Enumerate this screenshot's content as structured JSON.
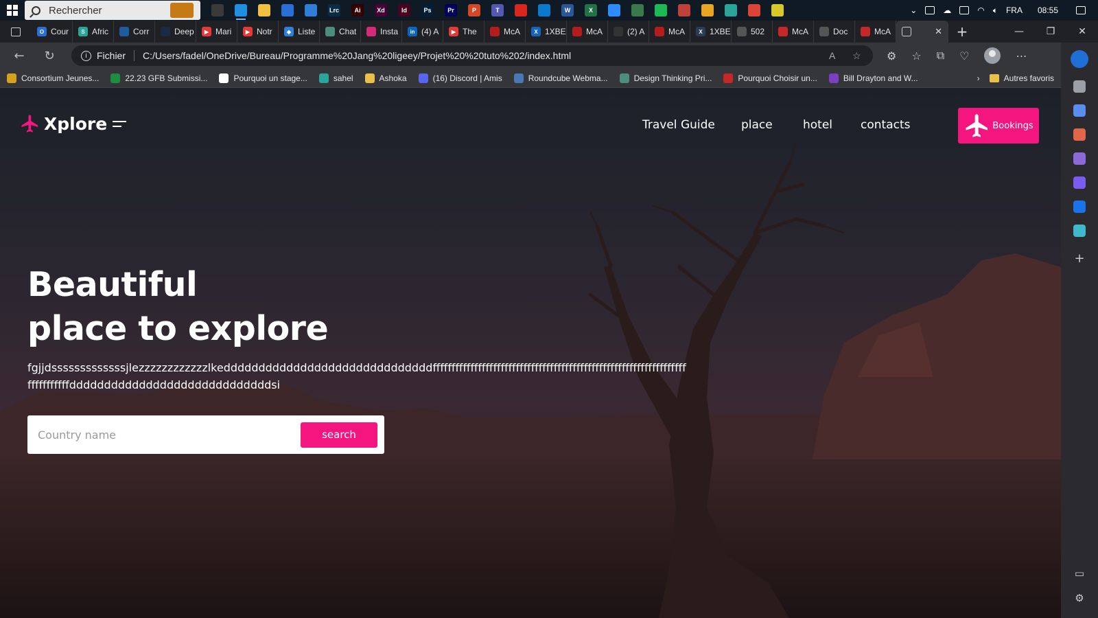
{
  "taskbar": {
    "search_placeholder": "Rechercher",
    "language": "FRA",
    "time": "08:55",
    "apps": [
      {
        "name": "task-view",
        "color": "#3a3a3a",
        "glyph": ""
      },
      {
        "name": "edge",
        "color": "#1f8fe0",
        "glyph": ""
      },
      {
        "name": "file-explorer",
        "color": "#f0c040",
        "glyph": ""
      },
      {
        "name": "store",
        "color": "#2b6fd6",
        "glyph": ""
      },
      {
        "name": "mail",
        "color": "#2f7fd8",
        "glyph": ""
      },
      {
        "name": "lightroom",
        "color": "#0b2a44",
        "glyph": "Lrc"
      },
      {
        "name": "illustrator",
        "color": "#330000",
        "glyph": "Ai"
      },
      {
        "name": "xd",
        "color": "#470137",
        "glyph": "Xd"
      },
      {
        "name": "indesign",
        "color": "#49021f",
        "glyph": "Id"
      },
      {
        "name": "photoshop",
        "color": "#001e36",
        "glyph": "Ps"
      },
      {
        "name": "premiere",
        "color": "#00005b",
        "glyph": "Pr"
      },
      {
        "name": "powerpoint",
        "color": "#d24726",
        "glyph": "P"
      },
      {
        "name": "teams",
        "color": "#5558af",
        "glyph": "T"
      },
      {
        "name": "acrobat",
        "color": "#d9261c",
        "glyph": ""
      },
      {
        "name": "vscode",
        "color": "#0a7acc",
        "glyph": ""
      },
      {
        "name": "word",
        "color": "#2b579a",
        "glyph": "W"
      },
      {
        "name": "excel",
        "color": "#217346",
        "glyph": "X"
      },
      {
        "name": "zoom",
        "color": "#2d8cff",
        "glyph": ""
      },
      {
        "name": "download",
        "color": "#3a7a4a",
        "glyph": ""
      },
      {
        "name": "spotify",
        "color": "#1db954",
        "glyph": ""
      },
      {
        "name": "app-circle",
        "color": "#c0403a",
        "glyph": ""
      },
      {
        "name": "chrome",
        "color": "#e7a521",
        "glyph": ""
      },
      {
        "name": "app-green",
        "color": "#2aa59a",
        "glyph": ""
      },
      {
        "name": "chrome-2",
        "color": "#db4437",
        "glyph": ""
      },
      {
        "name": "app-yellow",
        "color": "#d8c82a",
        "glyph": ""
      }
    ]
  },
  "tabs": [
    {
      "label": "Cour",
      "color": "#2b6fd6",
      "glyph": "O"
    },
    {
      "label": "Afric",
      "color": "#2aa59a",
      "glyph": "S"
    },
    {
      "label": "Corr",
      "color": "#1f5c9e",
      "glyph": ""
    },
    {
      "label": "Deep",
      "color": "#1b2a44",
      "glyph": ""
    },
    {
      "label": "Mari",
      "color": "#e53935",
      "glyph": "▶"
    },
    {
      "label": "Notr",
      "color": "#e53935",
      "glyph": "▶"
    },
    {
      "label": "Liste",
      "color": "#2f7fd8",
      "glyph": "◆"
    },
    {
      "label": "Chat",
      "color": "#4a8f7d",
      "glyph": ""
    },
    {
      "label": "Insta",
      "color": "#d62976",
      "glyph": ""
    },
    {
      "label": "(4) A",
      "color": "#0a66c2",
      "glyph": "in"
    },
    {
      "label": "The",
      "color": "#e53935",
      "glyph": "▶"
    },
    {
      "label": "McA",
      "color": "#b71c1c",
      "glyph": ""
    },
    {
      "label": "1XBE",
      "color": "#1565c0",
      "glyph": "X"
    },
    {
      "label": "McA",
      "color": "#b71c1c",
      "glyph": ""
    },
    {
      "label": "(2) A",
      "color": "#333",
      "glyph": ""
    },
    {
      "label": "McA",
      "color": "#b71c1c",
      "glyph": ""
    },
    {
      "label": "1XBE",
      "color": "#2b3c55",
      "glyph": "X"
    },
    {
      "label": "502",
      "color": "#555",
      "glyph": ""
    },
    {
      "label": "McA",
      "color": "#c62828",
      "glyph": ""
    },
    {
      "label": "Doc",
      "color": "#555",
      "glyph": ""
    },
    {
      "label": "McA",
      "color": "#c62828",
      "glyph": ""
    }
  ],
  "active_tab": {
    "label": ""
  },
  "address": {
    "scheme_label": "Fichier",
    "url": "C:/Users/fadel/OneDrive/Bureau/Programme%20Jang%20ligeey/Projet%20%20tuto%202/index.html"
  },
  "bookmarks": [
    {
      "label": "Consortium Jeunes...",
      "color": "#d6a21e"
    },
    {
      "label": "22.23 GFB Submissi...",
      "color": "#1e8e3e"
    },
    {
      "label": "Pourquoi un stage...",
      "color": "#ffffff"
    },
    {
      "label": "sahel",
      "color": "#2aa59a"
    },
    {
      "label": "Ashoka",
      "color": "#e8c04a"
    },
    {
      "label": "(16) Discord | Amis",
      "color": "#5865f2"
    },
    {
      "label": "Roundcube Webma...",
      "color": "#4a78b5"
    },
    {
      "label": "Design Thinking Pri...",
      "color": "#4a8f7d"
    },
    {
      "label": "Pourquoi Choisir un...",
      "color": "#c62828"
    },
    {
      "label": "Bill Drayton and W...",
      "color": "#7b3fc4"
    }
  ],
  "bookmarks_other": "Autres favoris",
  "sidebar_icons": [
    {
      "name": "search",
      "color": "#9aa0a6"
    },
    {
      "name": "tag",
      "color": "#5b8def"
    },
    {
      "name": "briefcase",
      "color": "#e0674a"
    },
    {
      "name": "games",
      "color": "#8b6ad8"
    },
    {
      "name": "copilot",
      "color": "#7a5cf0"
    },
    {
      "name": "outlook",
      "color": "#1a73e8"
    },
    {
      "name": "send",
      "color": "#3fb8c9"
    }
  ],
  "site": {
    "logo": "Xplore",
    "nav": [
      "Travel Guide",
      "place",
      "hotel",
      "contacts"
    ],
    "booking": "Bookings",
    "hero_line1": "Beautiful",
    "hero_line2": "place to explore",
    "hero_text": "fgjjdsssssssssssssjlezzzzzzzzzzzzlkeddddddddddddddddddddddddddddddffffffffffffffffffffffffffffffffffffffffffffffffffffffffffffffffffffffffffffffdddddddddddddddddddddddddddddsi",
    "search_placeholder": "Country name",
    "search_button": "search",
    "accent": "#f5157f"
  }
}
